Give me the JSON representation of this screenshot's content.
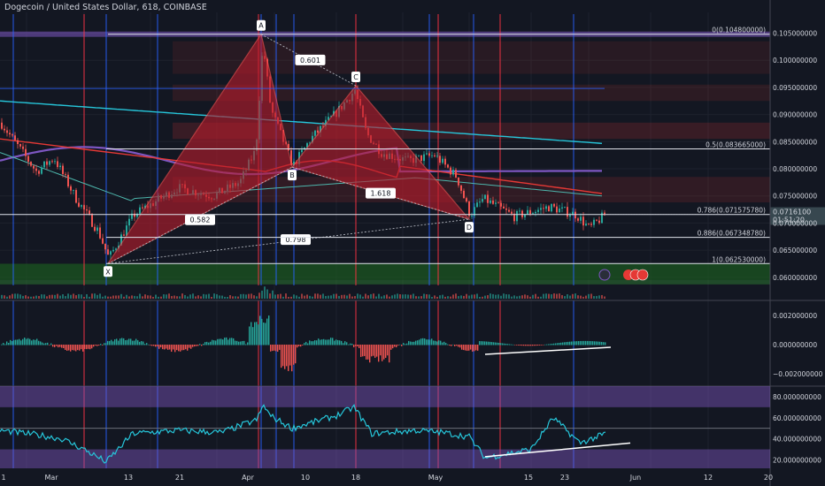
{
  "chart_title": "Dogecoin / United States Dollar, 618, COINBASE",
  "colors": {
    "background": "#131722",
    "axis_text": "#d1d4dc",
    "grid": "#1e222d",
    "pattern_fill": "#b71c2c",
    "pattern_stroke": "#ff5252",
    "price_line": "#ff5252",
    "red_vline": "#ff3344",
    "blue_vline": "#2962ff",
    "current_price_bg": "#37474f",
    "histogram_up": "#26a69a",
    "histogram_down": "#ef5350",
    "rsi_line": "#26c6da",
    "rsi_band": "#7e57c2",
    "cyan_ma": "#26c6da",
    "purple_ma": "#7e57c2",
    "red_ma": "#e53935"
  },
  "chart_data": [
    {
      "type": "candlestick",
      "price_axis_ticks": [
        "0.105000000",
        "0.100000000",
        "0.095000000",
        "0.090000000",
        "0.085000000",
        "0.080000000",
        "0.075000000",
        "0.070000000",
        "0.065000000",
        "0.060000000"
      ],
      "price_axis_values": [
        0.105,
        0.1,
        0.095,
        0.09,
        0.085,
        0.08,
        0.075,
        0.07,
        0.065,
        0.06
      ],
      "ylim": [
        0.0585,
        0.1085
      ],
      "current_price": "0.0716100",
      "countdown": "01:51:20",
      "x_ticks": [
        "1",
        "Mar",
        "13",
        "21",
        "Apr",
        "10",
        "18",
        "May",
        "15",
        "23",
        "Jun",
        "12",
        "20"
      ],
      "fib_levels": [
        {
          "label": "0(0.104800000)",
          "value": 0.1048
        },
        {
          "label": "0.5(0.083665000)",
          "value": 0.083665
        },
        {
          "label": "0.786(0.071575780)",
          "value": 0.07157578
        },
        {
          "label": "0.886(0.067348780)",
          "value": 0.06734878
        },
        {
          "label": "1(0.062530000)",
          "value": 0.06253
        }
      ],
      "harmonic_pattern": {
        "points": [
          {
            "label": "X",
            "value": 0.06253
          },
          {
            "label": "A",
            "value": 0.1048
          },
          {
            "label": "B",
            "value": 0.0803
          },
          {
            "label": "C",
            "value": 0.0953
          },
          {
            "label": "D",
            "value": 0.0707
          }
        ],
        "ratios": [
          "0.601",
          "0.582",
          "1.618",
          "0.798"
        ]
      },
      "indicators": [
        "cyan moving average",
        "purple moving average",
        "red moving average"
      ]
    },
    {
      "type": "histogram",
      "axis_ticks": [
        "0.002000000",
        "0.000000000",
        "−0.002000000"
      ],
      "axis_values": [
        0.002,
        0.0,
        -0.002
      ]
    },
    {
      "type": "line",
      "axis_ticks": [
        "80.000000000",
        "60.000000000",
        "40.000000000",
        "20.000000000"
      ],
      "axis_values": [
        80,
        60,
        40,
        20
      ],
      "ylim": [
        12,
        90
      ]
    }
  ]
}
